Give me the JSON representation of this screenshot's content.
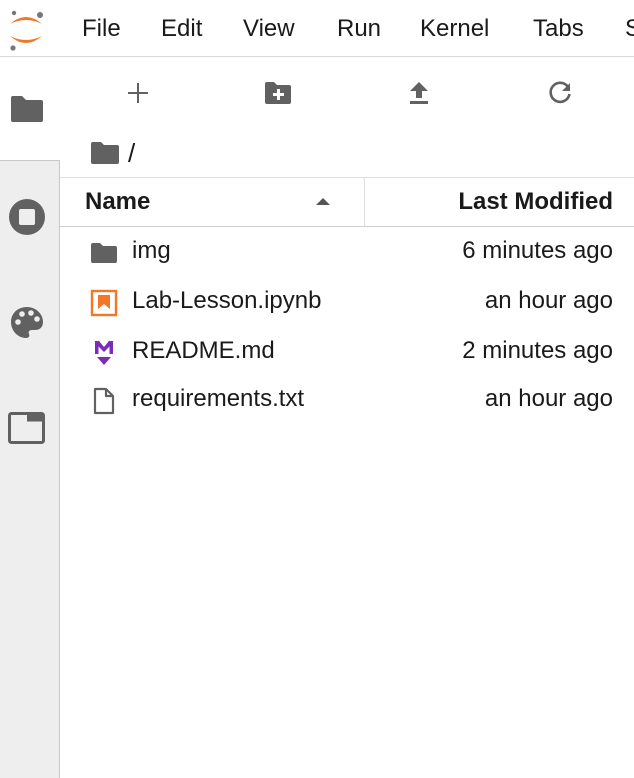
{
  "menubar": {
    "items": [
      "File",
      "Edit",
      "View",
      "Run",
      "Kernel",
      "Tabs",
      "S"
    ]
  },
  "colors": {
    "jupyter_orange": "#f37726",
    "icon_gray": "#616161",
    "markdown_purple": "#7b2cb8"
  },
  "activitybar": {
    "tabs": [
      {
        "icon": "folder-icon",
        "active": true
      },
      {
        "icon": "running-icon",
        "active": false
      },
      {
        "icon": "palette-icon",
        "active": false
      },
      {
        "icon": "tab-icon",
        "active": false
      }
    ]
  },
  "toolbar": {
    "buttons": [
      "add-icon",
      "new-folder-icon",
      "upload-icon",
      "refresh-icon"
    ]
  },
  "breadcrumb": {
    "path": "/"
  },
  "listing": {
    "headers": {
      "name": "Name",
      "modified": "Last Modified"
    },
    "sort": "ascending",
    "files": [
      {
        "name": "img",
        "modified": "6 minutes ago",
        "icon": "folder-icon"
      },
      {
        "name": "Lab-Lesson.ipynb",
        "modified": "an hour ago",
        "icon": "notebook-icon"
      },
      {
        "name": "README.md",
        "modified": "2 minutes ago",
        "icon": "markdown-icon"
      },
      {
        "name": "requirements.txt",
        "modified": "an hour ago",
        "icon": "text-file-icon"
      }
    ]
  }
}
